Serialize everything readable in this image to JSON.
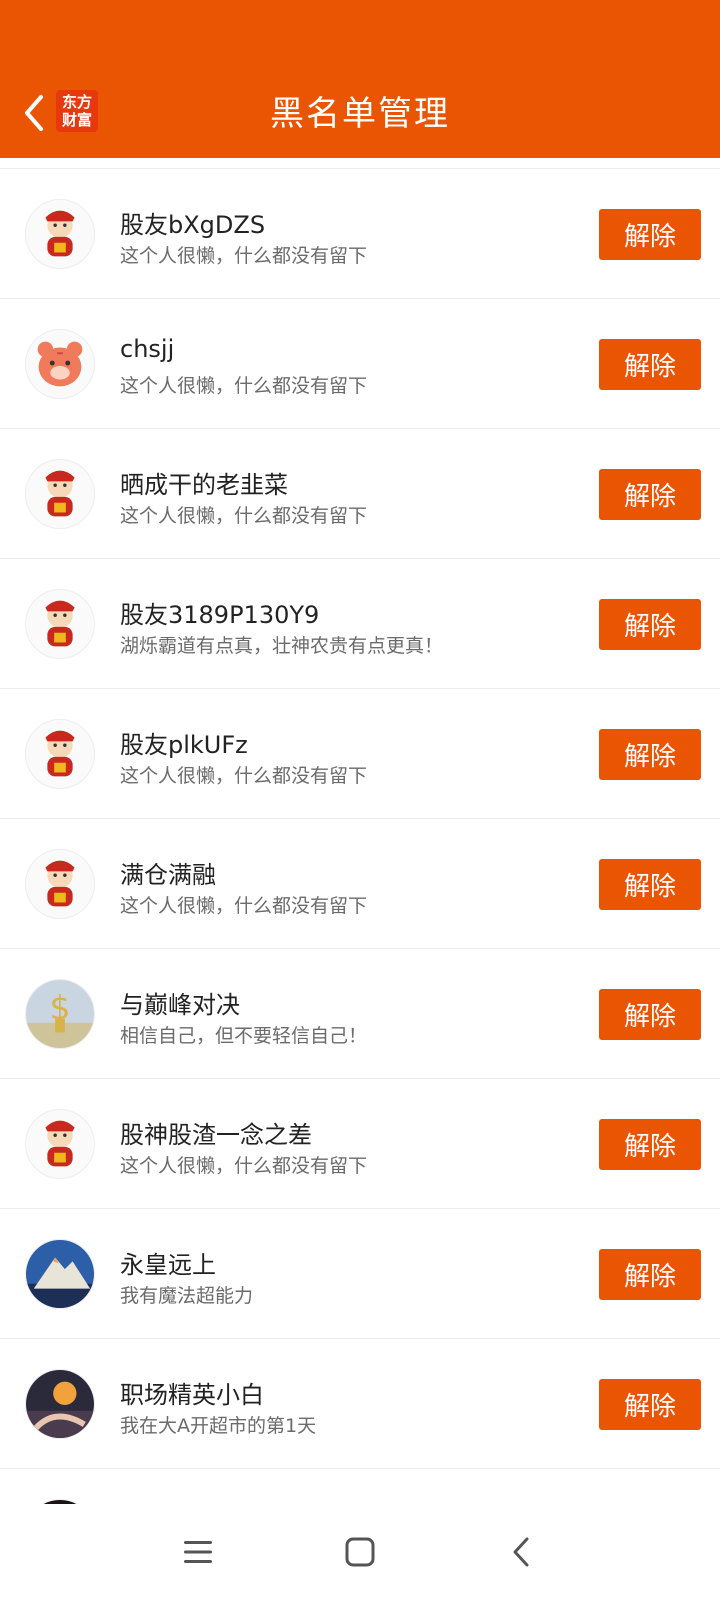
{
  "header": {
    "title": "黑名单管理",
    "logo_line1": "东方",
    "logo_line2": "财富"
  },
  "colors": {
    "brand": "#EA5504",
    "name_text": "#222222",
    "signature_text": "#6b6b6b"
  },
  "blacklist": [
    {
      "name": "股友bXgDZS",
      "signature": "这个人很懒，什么都没有留下",
      "button": "解除",
      "avatar": "fortune-god-avatar"
    },
    {
      "name": "chsjj",
      "signature": "这个人很懒，什么都没有留下",
      "button": "解除",
      "avatar": "tiger-avatar"
    },
    {
      "name": "晒成干的老韭菜",
      "signature": "这个人很懒，什么都没有留下",
      "button": "解除",
      "avatar": "fortune-god-avatar"
    },
    {
      "name": "股友3189P130Y9",
      "signature": "湖烁霸道有点真，壮神农贵有点更真！",
      "button": "解除",
      "avatar": "fortune-god-avatar"
    },
    {
      "name": "股友plkUFz",
      "signature": "这个人很懒，什么都没有留下",
      "button": "解除",
      "avatar": "fortune-god-avatar"
    },
    {
      "name": "满仓满融",
      "signature": "这个人很懒，什么都没有留下",
      "button": "解除",
      "avatar": "fortune-god-avatar"
    },
    {
      "name": "与巅峰对决",
      "signature": "相信自己，但不要轻信自己！",
      "button": "解除",
      "avatar": "dollar-photo-avatar"
    },
    {
      "name": "股神股渣一念之差",
      "signature": "这个人很懒，什么都没有留下",
      "button": "解除",
      "avatar": "fortune-god-avatar"
    },
    {
      "name": "永皇远上",
      "signature": "我有魔法超能力",
      "button": "解除",
      "avatar": "mountain-photo-avatar"
    },
    {
      "name": "职场精英小白",
      "signature": "我在大A开超市的第1天",
      "button": "解除",
      "avatar": "sunset-photo-avatar"
    }
  ],
  "navbar": {
    "icons": [
      "menu-icon",
      "home-square-icon",
      "back-triangle-icon"
    ]
  }
}
